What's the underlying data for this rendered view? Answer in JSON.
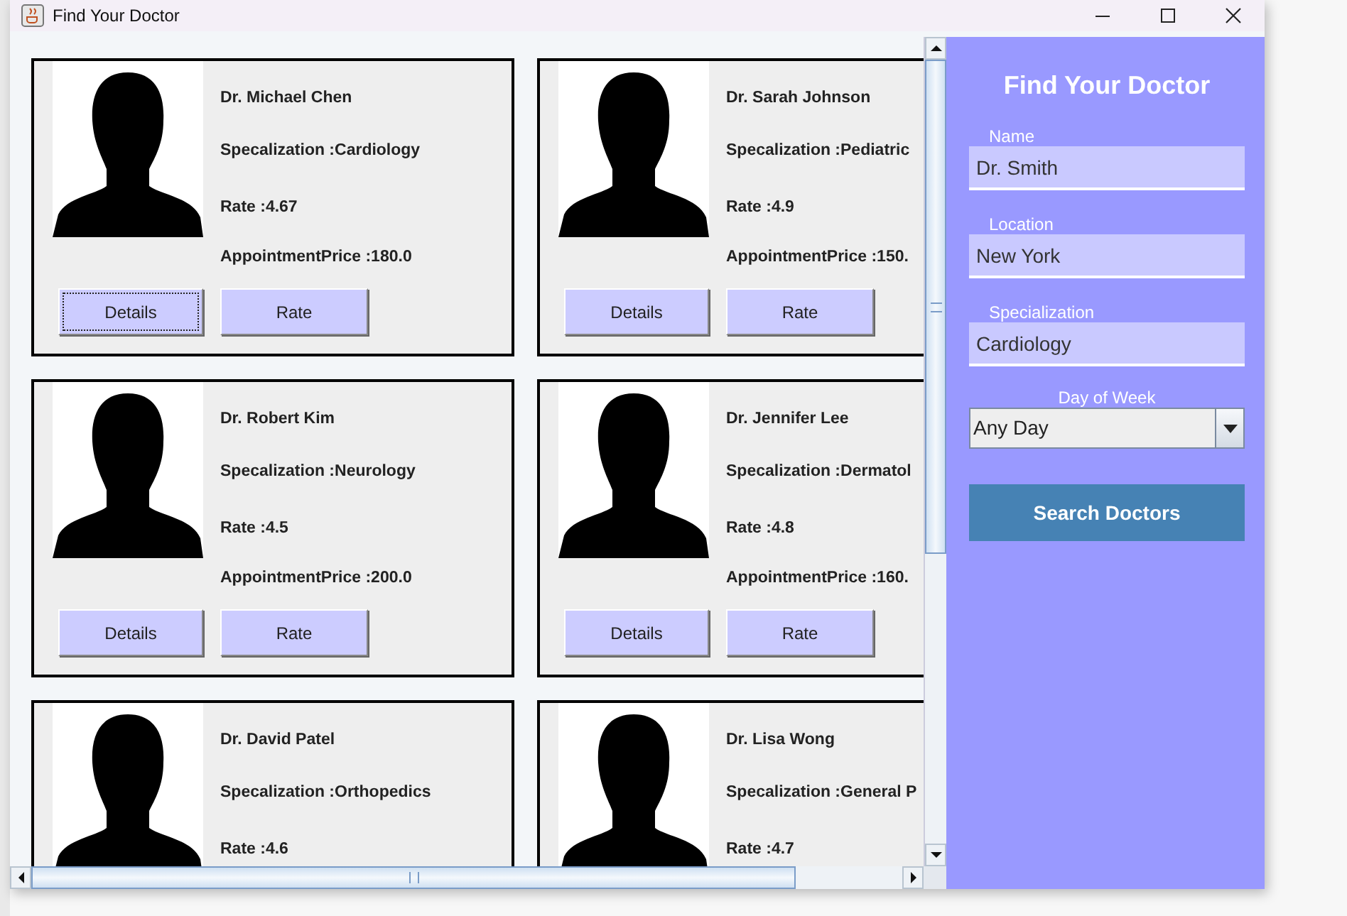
{
  "window": {
    "title": "Find Your Doctor"
  },
  "doctors": [
    {
      "name": "Dr. Michael Chen",
      "specialization": "Specalization :Cardiology",
      "rate": "Rate :4.67",
      "price": "AppointmentPrice :180.0",
      "buttons": [
        {
          "label": "Details",
          "focused": true
        },
        {
          "label": "Rate",
          "focused": false
        }
      ]
    },
    {
      "name": "Dr. Sarah Johnson",
      "specialization": "Specalization :Pediatric",
      "rate": "Rate :4.9",
      "price": "AppointmentPrice :150.",
      "buttons": [
        {
          "label": "Details",
          "focused": false
        },
        {
          "label": "Rate",
          "focused": false
        }
      ]
    },
    {
      "name": "Dr. Robert Kim",
      "specialization": "Specalization :Neurology",
      "rate": "Rate :4.5",
      "price": "AppointmentPrice :200.0",
      "buttons": [
        {
          "label": "Details",
          "focused": false
        },
        {
          "label": "Rate",
          "focused": false
        }
      ]
    },
    {
      "name": "Dr. Jennifer Lee",
      "specialization": "Specalization :Dermatol",
      "rate": "Rate :4.8",
      "price": "AppointmentPrice :160.",
      "buttons": [
        {
          "label": "Details",
          "focused": false
        },
        {
          "label": "Rate",
          "focused": false
        }
      ]
    },
    {
      "name": "Dr. David Patel",
      "specialization": "Specalization :Orthopedics",
      "rate": "Rate :4.6"
    },
    {
      "name": "Dr. Lisa Wong",
      "specialization": "Specalization :General P",
      "rate": "Rate :4.7"
    }
  ],
  "search_panel": {
    "title": "Find Your Doctor",
    "fields": [
      {
        "label": "Name",
        "value": "Dr. Smith"
      },
      {
        "label": "Location",
        "value": "New York"
      },
      {
        "label": "Specialization",
        "value": "Cardiology"
      }
    ],
    "day_field": {
      "label": "Day of Week",
      "value": "Any Day"
    },
    "button": "Search Doctors"
  }
}
